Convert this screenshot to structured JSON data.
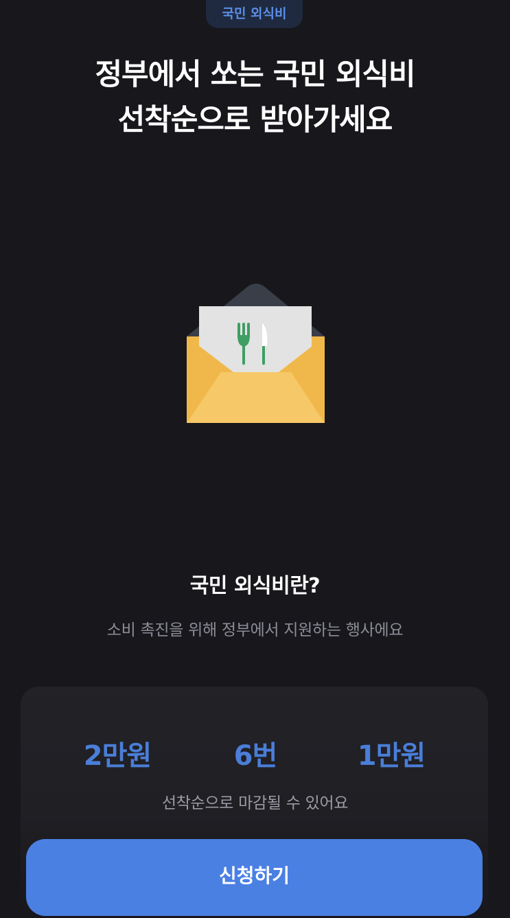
{
  "header": {
    "chip_label": "국민 외식비",
    "headline_line1": "정부에서 쏘는 국민 외식비",
    "headline_line2": "선착순으로 받아가세요"
  },
  "illustration": {
    "icon": "envelope-with-fork-knife-card",
    "colors": {
      "envelope_back": "#f0b84a",
      "envelope_front": "#f6c867",
      "envelope_flap": "#3a3e48",
      "card": "#e3e3e3",
      "utensils": "#3f9e63"
    }
  },
  "info": {
    "title": "국민 외식비란?",
    "description": "소비 촉진을 위해 정부에서 지원하는 행사에요"
  },
  "stats": [
    {
      "value": "2만원"
    },
    {
      "value": "6번"
    },
    {
      "value": "1만원"
    }
  ],
  "notice": "선착순으로 마감될 수 있어요",
  "cta": {
    "label": "신청하기"
  },
  "colors": {
    "background": "#17171c",
    "accent": "#4b80e3",
    "stat_text": "#4a7ed8",
    "muted_text": "#8d8d97"
  }
}
